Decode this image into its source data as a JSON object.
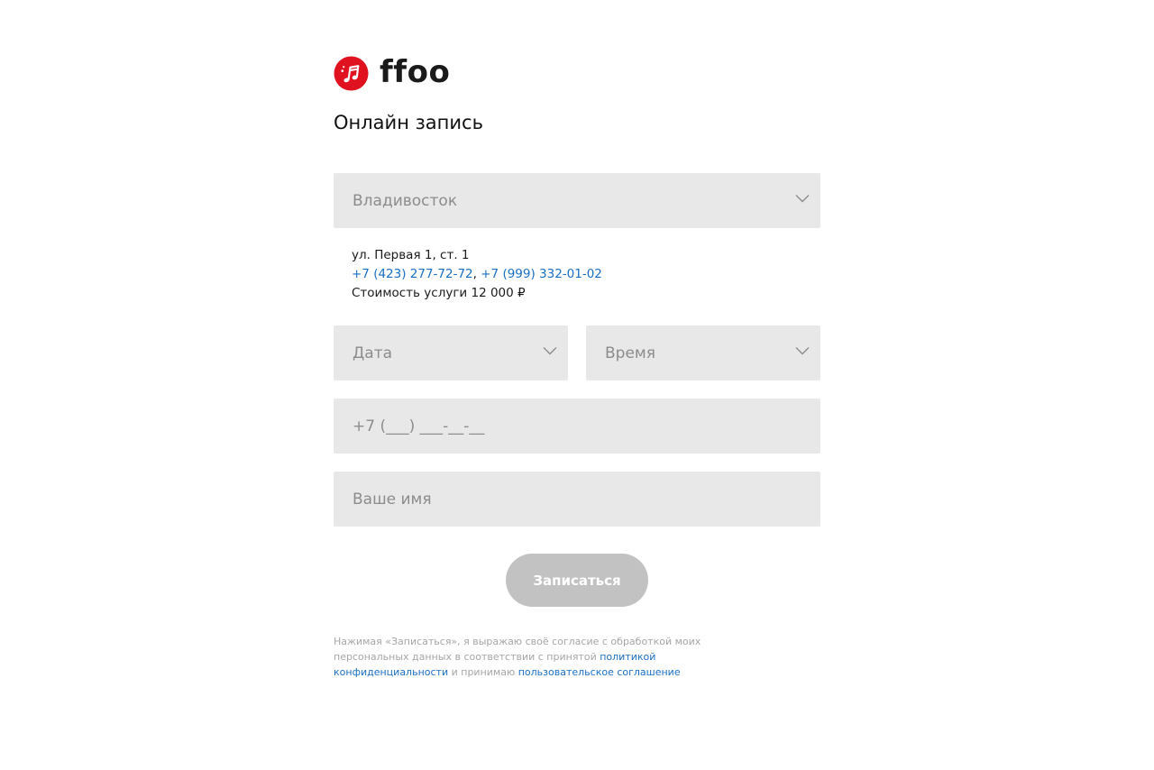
{
  "brand": {
    "name": "ffoo",
    "accent_color": "#e0121f",
    "logo_icon": "music-note-icon"
  },
  "page": {
    "title": "Онлайн запись"
  },
  "form": {
    "city": {
      "value": "Владивосток",
      "icon": "chevron-down-icon"
    },
    "branch": {
      "address": "ул. Первая 1, ст. 1",
      "phone_1": "+7 (423) 277-72-72",
      "phone_sep": ", ",
      "phone_2": "+7 (999) 332-01-02",
      "price": "Стоимость услуги 12 000 ₽"
    },
    "date": {
      "placeholder": "Дата",
      "icon": "chevron-down-icon"
    },
    "time": {
      "placeholder": "Время",
      "icon": "chevron-down-icon"
    },
    "phone": {
      "placeholder": "+7 (___) ___-__-__"
    },
    "name": {
      "placeholder": "Ваше имя"
    },
    "submit_label": "Записаться",
    "submit_color": "#c2c2c2"
  },
  "consent": {
    "text_1": "Нажимая «Записаться», я выражаю своё согласие с обработкой моих персональных данных в соответствии с принятой ",
    "privacy_link": "политикой конфиденциальности",
    "text_2": " и принимаю ",
    "agreement_link": "пользовательское соглашение",
    "link_color": "#1a6fc4"
  }
}
